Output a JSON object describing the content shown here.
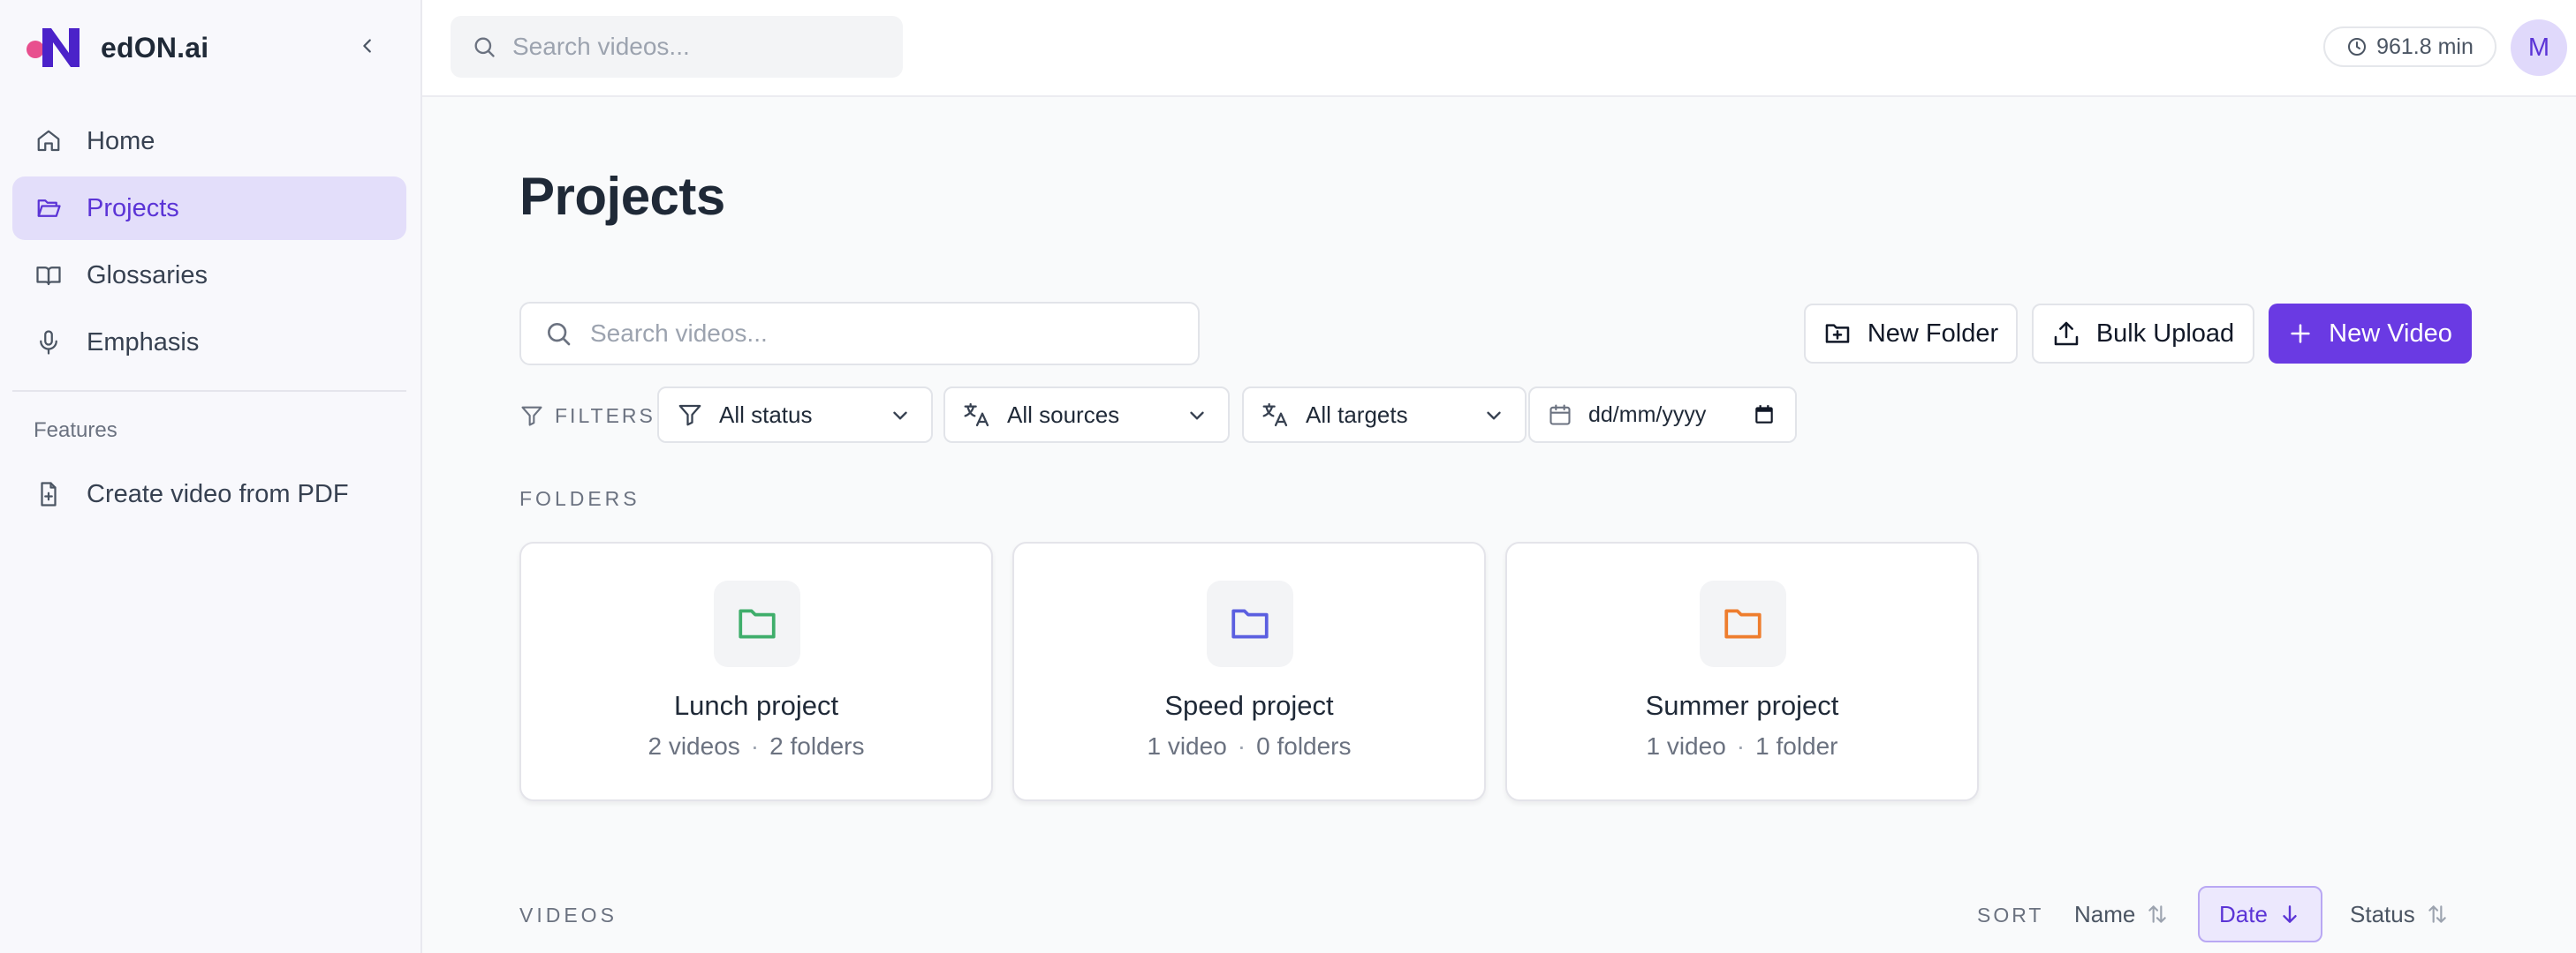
{
  "brand": {
    "name": "edON.ai"
  },
  "sidebar": {
    "items": [
      {
        "label": "Home",
        "icon": "home-icon"
      },
      {
        "label": "Projects",
        "icon": "folder-open-icon",
        "active": true
      },
      {
        "label": "Glossaries",
        "icon": "book-icon"
      },
      {
        "label": "Emphasis",
        "icon": "mic-icon"
      }
    ],
    "features_label": "Features",
    "features": [
      {
        "label": "Create video from PDF",
        "icon": "file-plus-icon"
      }
    ]
  },
  "topbar": {
    "search_placeholder": "Search videos...",
    "usage": "961.8 min",
    "avatar_initial": "M"
  },
  "main": {
    "title": "Projects",
    "search_placeholder": "Search videos...",
    "buttons": {
      "new_folder": "New Folder",
      "bulk_upload": "Bulk Upload",
      "new_video": "New Video"
    },
    "filters": {
      "label": "FILTERS",
      "status": "All status",
      "sources": "All sources",
      "targets": "All targets",
      "date_placeholder": "dd/mm/yyyy"
    },
    "folders_label": "FOLDERS",
    "folders": [
      {
        "name": "Lunch project",
        "videos": "2 videos",
        "folders": "2 folders",
        "color": "#3fae6b"
      },
      {
        "name": "Speed project",
        "videos": "1 video",
        "folders": "0 folders",
        "color": "#5b5fe0"
      },
      {
        "name": "Summer project",
        "videos": "1 video",
        "folders": "1 folder",
        "color": "#ee7d2e"
      }
    ],
    "videos_label": "VIDEOS",
    "sort": {
      "label": "SORT",
      "name": "Name",
      "date": "Date",
      "status": "Status",
      "active": "date"
    }
  },
  "colors": {
    "accent": "#6a3ae3",
    "active_nav_bg": "#e3defa",
    "logo_dot": "#e84f8e"
  }
}
